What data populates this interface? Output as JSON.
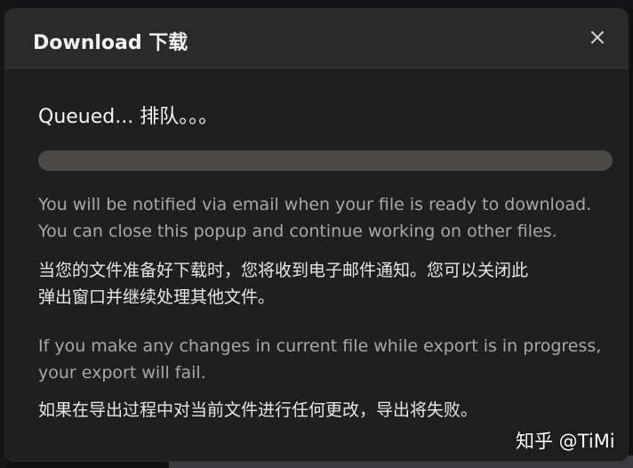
{
  "modal": {
    "title": "Download 下载",
    "close_icon": "close-icon",
    "status": "Queued... 排队。。。",
    "progress": 0,
    "notify_en_line1": "You will be notified via email when your file is ready to download.",
    "notify_en_line2": "You can close this popup and continue working on other files.",
    "notify_zh_line1": "当您的文件准备好下载时，您将收到电子邮件通知。您可以关闭此",
    "notify_zh_line2": "弹出窗口并继续处理其他文件。",
    "warn_en_line1": "If you make any changes in current file while export is in progress,",
    "warn_en_line2": "your export will fail.",
    "warn_zh_line1": "如果在导出过程中对当前文件进行任何更改，导出将失败。"
  },
  "watermark": "知乎 @TiMi",
  "colors": {
    "modal_bg": "#1f1f20",
    "header_bg": "#2a2a2b",
    "track": "#4b4a47"
  }
}
